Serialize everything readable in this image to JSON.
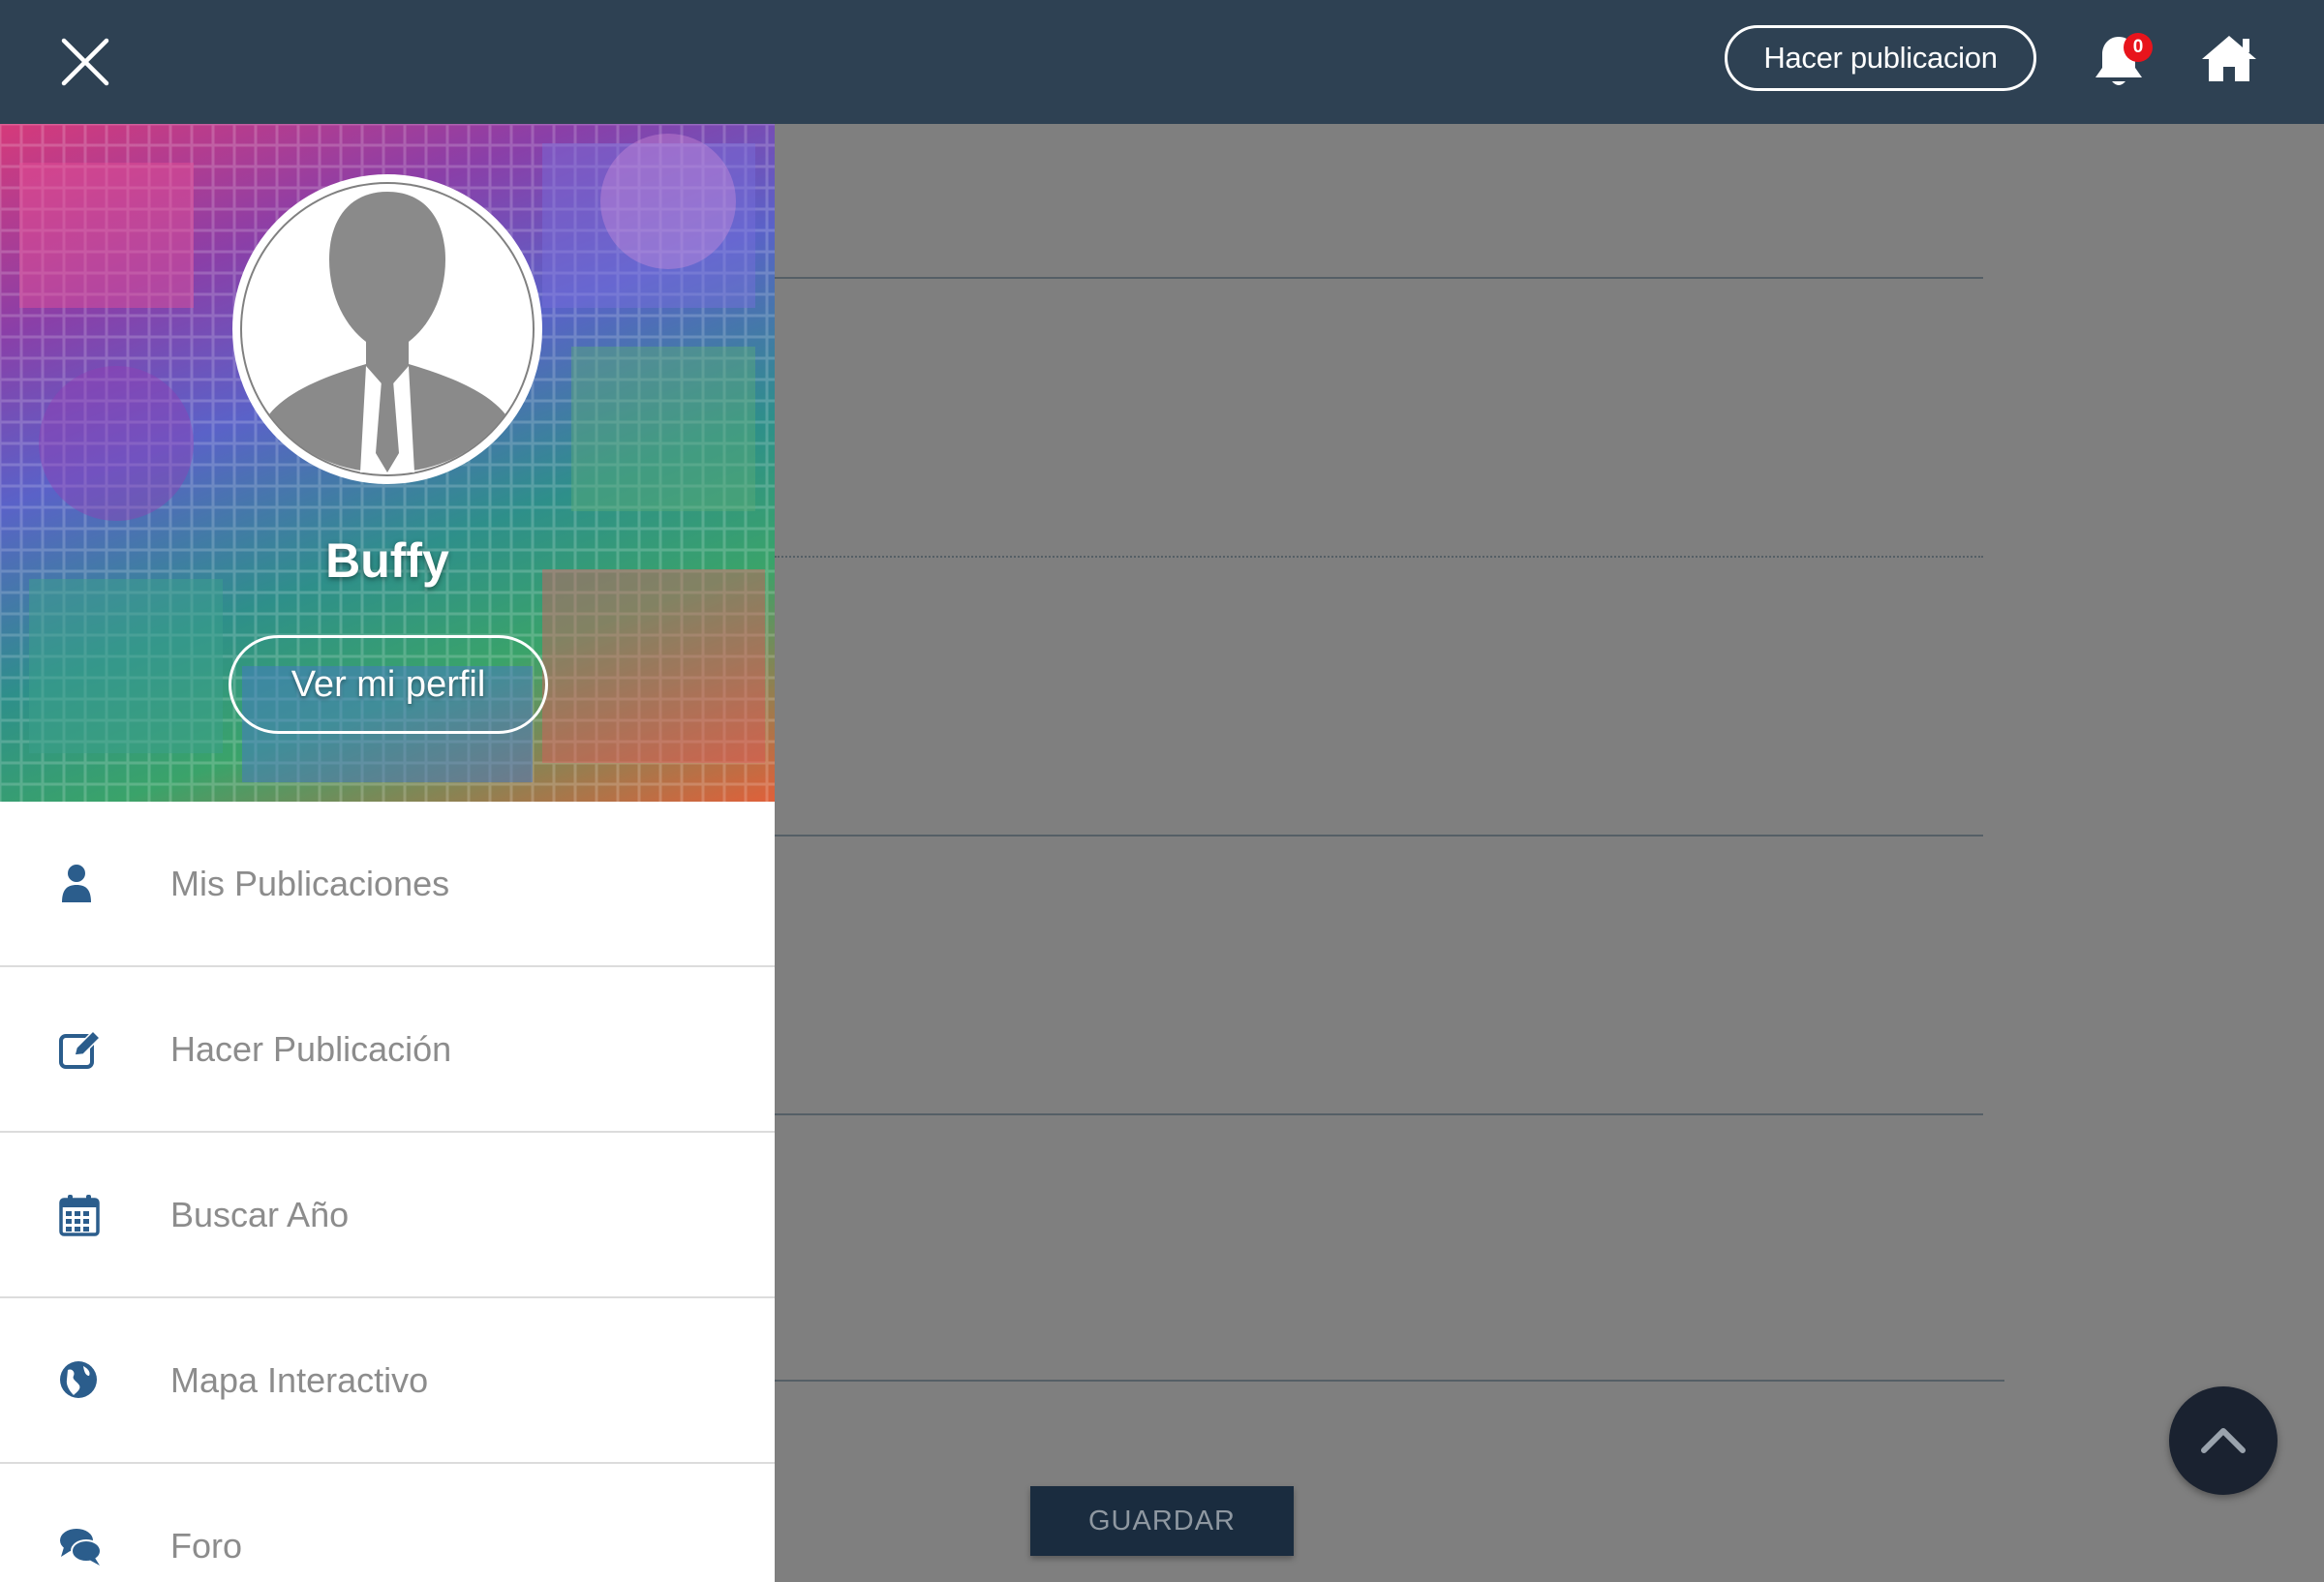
{
  "topbar": {
    "close_icon": "close-icon",
    "publish_label": "Hacer publicacion",
    "notifications_count": "0",
    "bell_icon": "bell-icon",
    "home_icon": "home-icon",
    "bg_color": "#2e4153"
  },
  "drawer": {
    "username": "Buffy",
    "profile_button": "Ver mi perfil",
    "avatar_icon": "default-user-avatar",
    "items": [
      {
        "label": "Mis Publicaciones",
        "icon": "user-icon"
      },
      {
        "label": "Hacer Publicación",
        "icon": "edit-icon"
      },
      {
        "label": "Buscar Año",
        "icon": "calendar-icon"
      },
      {
        "label": "Mapa Interactivo",
        "icon": "globe-icon"
      },
      {
        "label": "Foro",
        "icon": "comments-icon"
      }
    ],
    "icon_color": "#2b5d8c"
  },
  "form": {
    "save_label": "GUARDAR"
  },
  "scroll_top_icon": "chevron-up-icon"
}
